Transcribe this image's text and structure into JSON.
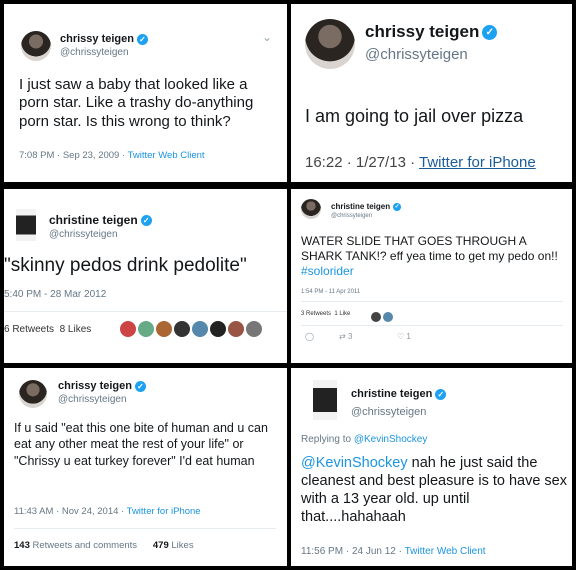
{
  "cards": [
    {
      "name": "chrissy teigen",
      "handle": "@chrissyteigen",
      "text": "I just saw a baby that looked like a porn star. Like a trashy do-anything porn star. Is this wrong to think?",
      "time": "7:08 PM · Sep 23, 2009 · ",
      "client": "Twitter Web Client"
    },
    {
      "name": "chrissy teigen",
      "handle": "@chrissyteigen",
      "text": "I am going to jail over pizza",
      "time": "16:22 · 1/27/13 · ",
      "client": "Twitter for iPhone"
    },
    {
      "name": "christine teigen",
      "handle": "@chrissyteigen",
      "text": "\"skinny pedos drink pedolite\"",
      "time": "5:40 PM - 28 Mar 2012",
      "retweets": "6 Retweets",
      "likes": "8 Likes"
    },
    {
      "name": "christine teigen",
      "handle": "@chrissyteigen",
      "text": "WATER SLIDE THAT GOES THROUGH A SHARK TANK!? eff yea time to get my pedo on!! ",
      "hashtag": "#solorider",
      "time": "1:54 PM - 11 Apr 2011",
      "retweets": "3 Retweets",
      "likes": "1 Like",
      "reply_count": "",
      "rt_count": "3",
      "like_count": "1"
    },
    {
      "name": "chrissy teigen",
      "handle": "@chrissyteigen",
      "text": "If u said \"eat this one bite of human and u can eat any other meat the rest of your life\" or \"Chrissy u eat turkey forever\" I'd eat human",
      "time": "11:43 AM · Nov 24, 2014 · ",
      "client": "Twitter for iPhone",
      "retweets_num": "143",
      "retweets_label": "Retweets and comments",
      "likes_num": "479",
      "likes_label": "Likes"
    },
    {
      "name": "christine teigen",
      "handle": "@chrissyteigen",
      "replying_prefix": "Replying to ",
      "replying_to": "@KevinShockey",
      "mention": "@KevinShockey",
      "text": " nah he just said the cleanest and best pleasure is to have sex with a 13 year old. up until that....hahahaah",
      "time": "11:56 PM · 24 Jun 12 · ",
      "client": "Twitter Web Client"
    }
  ]
}
